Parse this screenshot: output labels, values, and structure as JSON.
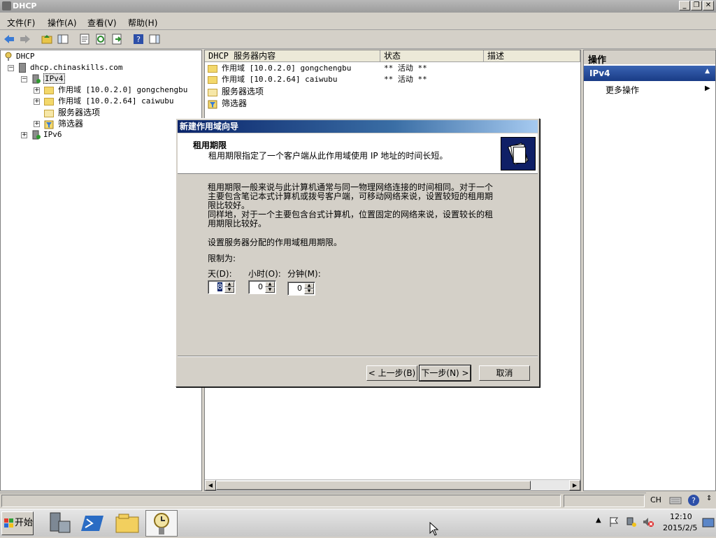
{
  "window": {
    "title": "DHCP",
    "min": "_",
    "restore": "❐",
    "close": "✕"
  },
  "menu": [
    "文件(F)",
    "操作(A)",
    "查看(V)",
    "帮助(H)"
  ],
  "tree": {
    "root": "DHCP",
    "server": "dhcp.chinaskills.com",
    "ipv4": "IPv4",
    "scope1": "作用域 [10.0.2.0] gongchengbu",
    "scope2": "作用域 [10.0.2.64] caiwubu",
    "options": "服务器选项",
    "filters": "筛选器",
    "ipv6": "IPv6"
  },
  "list": {
    "headers": [
      "DHCP 服务器内容",
      "状态",
      "描述"
    ],
    "rows": [
      {
        "name": "作用域 [10.0.2.0] gongchengbu",
        "status": "** 活动 **"
      },
      {
        "name": "作用域 [10.0.2.64] caiwubu",
        "status": "** 活动 **"
      },
      {
        "name": "服务器选项",
        "status": ""
      },
      {
        "name": "筛选器",
        "status": ""
      }
    ]
  },
  "actions": {
    "header": "操作",
    "selected": "IPv4",
    "more": "更多操作"
  },
  "dialog": {
    "title": "新建作用域向导",
    "heading": "租用期限",
    "subheading": "租用期限指定了一个客户端从此作用域使用 IP 地址的时间长短。",
    "para1_l1": "租用期限一般来说与此计算机通常与同一物理网络连接的时间相同。对于一个",
    "para1_l2": "主要包含笔记本式计算机或拨号客户端，可移动网络来说，设置较短的租用期",
    "para1_l3": "限比较好。",
    "para2_l1": "同样地，对于一个主要包含台式计算机，位置固定的网络来说，设置较长的租",
    "para2_l2": "用期限比较好。",
    "para3": "设置服务器分配的作用域租用期限。",
    "limit_label": "限制为:",
    "days_label": "天(D):",
    "hours_label": "小时(O):",
    "minutes_label": "分钟(M):",
    "days_value": "8",
    "hours_value": "0",
    "minutes_value": "0",
    "back": "< 上一步(B)",
    "next": "下一步(N) >",
    "cancel": "取消"
  },
  "status": {
    "lang": "CH"
  },
  "taskbar": {
    "start": "开始",
    "time": "12:10",
    "date": "2015/2/5"
  }
}
